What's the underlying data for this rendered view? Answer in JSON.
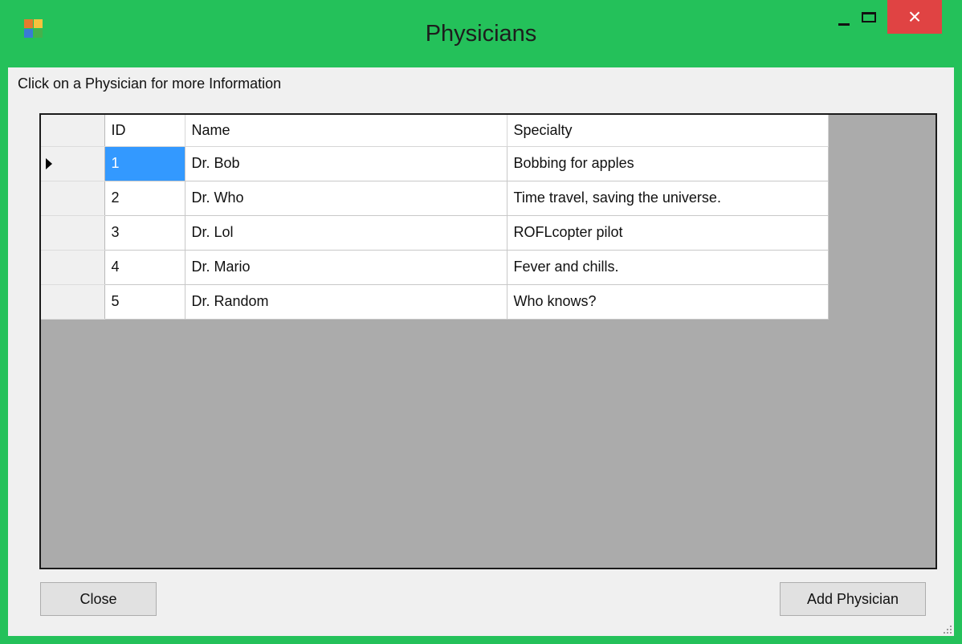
{
  "window": {
    "title": "Physicians",
    "close_glyph": "×"
  },
  "instruction": "Click on a Physician for more Information",
  "grid": {
    "columns": [
      "ID",
      "Name",
      "Specialty"
    ],
    "rows": [
      {
        "id": "1",
        "name": "Dr. Bob",
        "specialty": "Bobbing for apples"
      },
      {
        "id": "2",
        "name": "Dr. Who",
        "specialty": "Time travel, saving the universe."
      },
      {
        "id": "3",
        "name": "Dr. Lol",
        "specialty": "ROFLcopter pilot"
      },
      {
        "id": "4",
        "name": "Dr. Mario",
        "specialty": "Fever and chills."
      },
      {
        "id": "5",
        "name": "Dr. Random",
        "specialty": "Who knows?"
      }
    ]
  },
  "buttons": {
    "close": "Close",
    "add": "Add Physician"
  },
  "icons": {
    "app": "application-icon",
    "minimize": "minimize-icon",
    "maximize": "maximize-icon",
    "close": "close-icon",
    "row_selector": "current-row-arrow-icon",
    "resize": "resize-grip-icon"
  },
  "colors": {
    "window_border": "#24c15a",
    "close_button": "#e04343",
    "selection": "#3399ff",
    "grid_background": "#ababab"
  }
}
